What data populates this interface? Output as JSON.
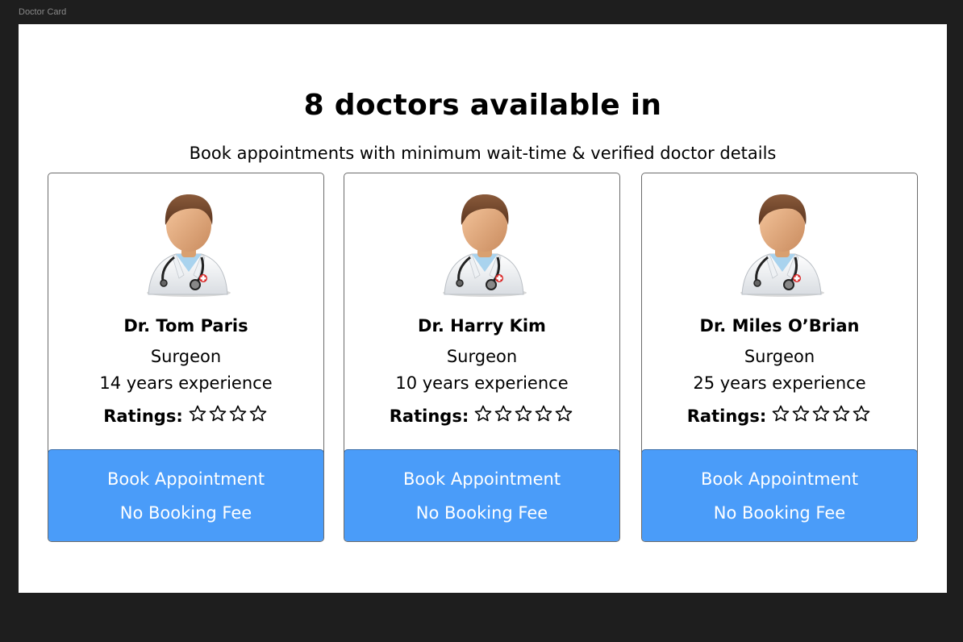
{
  "window": {
    "frame_label": "Doctor Card"
  },
  "header": {
    "title": "8 doctors available in",
    "subtitle": "Book appointments with minimum wait-time & verified doctor details"
  },
  "colors": {
    "button_bg": "#4a9cf9",
    "button_border": "#3f6fa8",
    "card_border": "#6b6b6b",
    "canvas_bg": "#1e1e1e"
  },
  "doctors": [
    {
      "name": "Dr. Tom Paris",
      "specialty": "Surgeon",
      "experience": "14 years experience",
      "ratings_label": "Ratings:",
      "stars_total": 4,
      "stars_filled": 0,
      "avatar_icon": "doctor-avatar-icon",
      "button_line1": "Book Appointment",
      "button_line2": "No Booking Fee"
    },
    {
      "name": "Dr. Harry Kim",
      "specialty": "Surgeon",
      "experience": "10 years experience",
      "ratings_label": "Ratings:",
      "stars_total": 5,
      "stars_filled": 0,
      "avatar_icon": "doctor-avatar-icon",
      "button_line1": "Book Appointment",
      "button_line2": "No Booking Fee"
    },
    {
      "name": "Dr. Miles O’Brian",
      "specialty": "Surgeon",
      "experience": "25 years experience",
      "ratings_label": "Ratings:",
      "stars_total": 5,
      "stars_filled": 0,
      "avatar_icon": "doctor-avatar-icon",
      "button_line1": "Book Appointment",
      "button_line2": "No Booking Fee"
    }
  ]
}
